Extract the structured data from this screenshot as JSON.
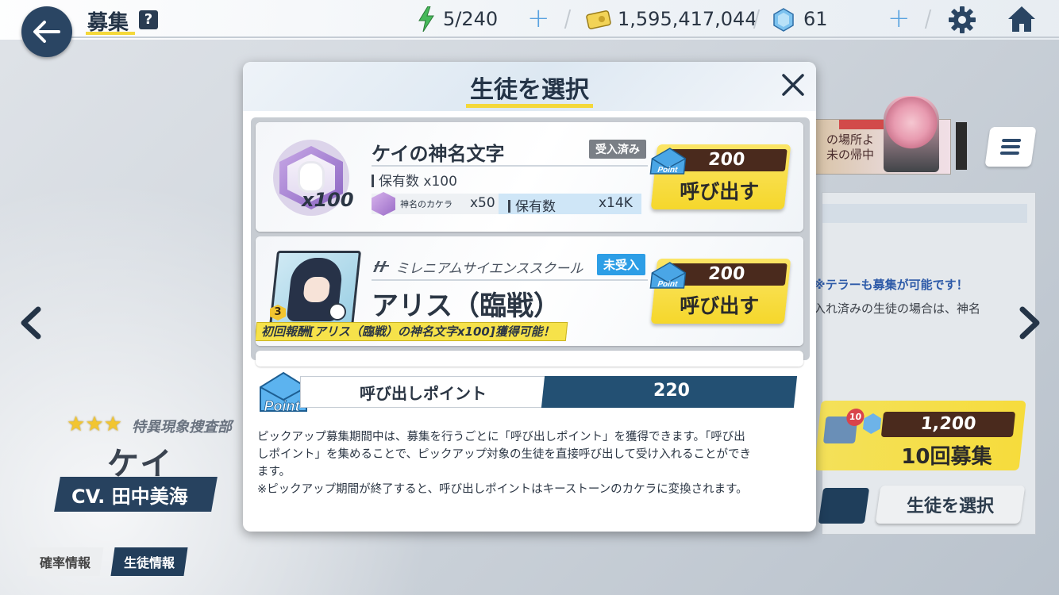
{
  "header": {
    "title": "募集",
    "help": "?",
    "ap": "5/240",
    "credits": "1,595,417,044",
    "pyroxene": "61"
  },
  "background": {
    "notice_blue": "※テラーも募集が可能です！",
    "notice_gray": "入れ済みの生徒の場合は、神名",
    "banner_text": "の場所よ\n未の帰中",
    "ten_pull_price": "1,200",
    "ten_pull_label": "10回募集",
    "ten_pull_badge": "10",
    "select_student_button": "生徒を選択",
    "character_school": "特異現象捜査部",
    "character_name": "ケイ",
    "character_cv": "CV. 田中美海",
    "tab_rate": "確率情報",
    "tab_student": "生徒情報"
  },
  "modal": {
    "title": "生徒を選択",
    "items": [
      {
        "name": "ケイの神名文字",
        "status": "受入済み",
        "icon_count": "x100",
        "owned_label": "保有数",
        "owned_value": "x100",
        "material_name": "神名のカケラ",
        "material_qty": "x50",
        "material_owned_label": "保有数",
        "material_owned_value": "x14K",
        "cost": "200",
        "button_label": "呼び出す"
      },
      {
        "school": "ミレニアムサイエンススクール",
        "name": "アリス（臨戦）",
        "status": "未受入",
        "rank": "3",
        "reward": "初回報酬[アリス（臨戦）の神名文字x100]獲得可能！",
        "cost": "200",
        "button_label": "呼び出す"
      }
    ],
    "points_label": "呼び出しポイント",
    "points_value": "220",
    "point_icon_text": "Point",
    "description": [
      "ピックアップ募集期間中は、募集を行うごとに「呼び出しポイント」を獲得できます。「呼び出",
      "しポイント」を集めることで、ピックアップ対象の生徒を直接呼び出して受け入れることができ",
      "ます。",
      "※ピックアップ期間が終了すると、呼び出しポイントはキーストーンのカケラに変換されます。"
    ]
  },
  "colors": {
    "accent_yellow": "#f4d83a",
    "navy": "#243447",
    "points_bar": "#235073",
    "badge_blue": "#2d9ee6",
    "badge_gray": "#7a7f86"
  }
}
